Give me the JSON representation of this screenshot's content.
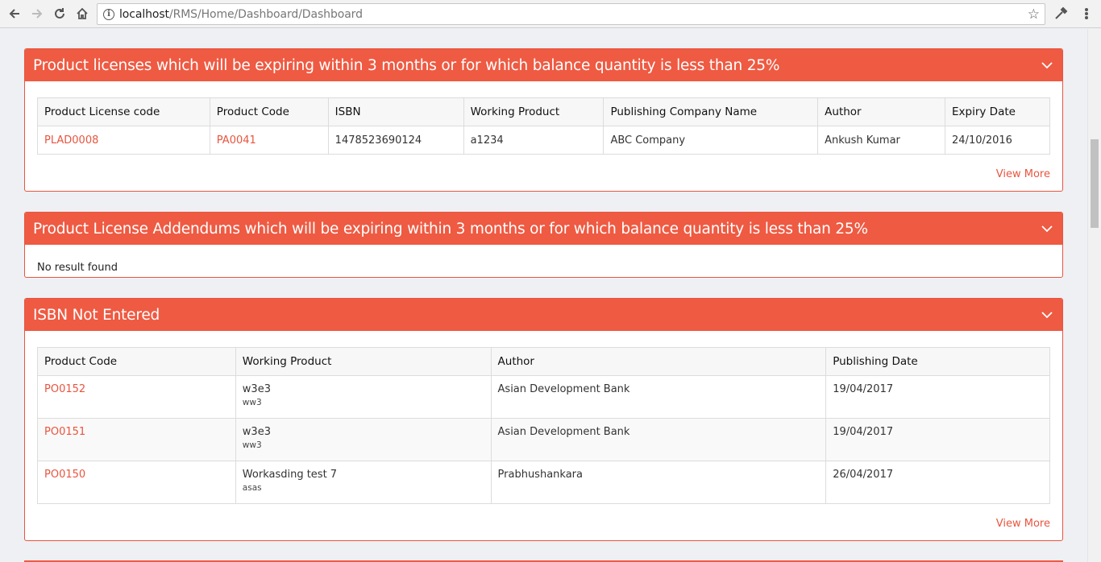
{
  "browser": {
    "url_host": "localhost",
    "url_path": "/RMS/Home/Dashboard/Dashboard"
  },
  "panels": {
    "licenses": {
      "title": "Product licenses which will be expiring within 3 months or for which balance quantity is less than 25%",
      "columns": [
        "Product License code",
        "Product Code",
        "ISBN",
        "Working Product",
        "Publishing Company Name",
        "Author",
        "Expiry Date"
      ],
      "rows": [
        [
          "PLAD0008",
          "PA0041",
          "1478523690124",
          "a1234",
          "ABC Company",
          "Ankush Kumar",
          "24/10/2016"
        ]
      ],
      "view_more": "View More"
    },
    "addendums": {
      "title": "Product License Addendums which will be expiring within 3 months or for which balance quantity is less than 25%",
      "empty_text": "No result found"
    },
    "isbn": {
      "title": "ISBN Not Entered",
      "columns": [
        "Product Code",
        "Working Product",
        "Author",
        "Publishing Date"
      ],
      "rows": [
        {
          "code": "PO0152",
          "product": "w3e3",
          "product_sub": "ww3",
          "author": "Asian Development Bank",
          "date": "19/04/2017"
        },
        {
          "code": "PO0151",
          "product": "w3e3",
          "product_sub": "ww3",
          "author": "Asian Development Bank",
          "date": "19/04/2017"
        },
        {
          "code": "PO0150",
          "product": "Workasding test 7",
          "product_sub": "asas",
          "author": "Prabhushankara",
          "date": "26/04/2017"
        }
      ],
      "view_more": "View More"
    }
  },
  "colors": {
    "accent": "#ef5a42",
    "link": "#e8553f",
    "page_bg": "#eef0f4"
  }
}
